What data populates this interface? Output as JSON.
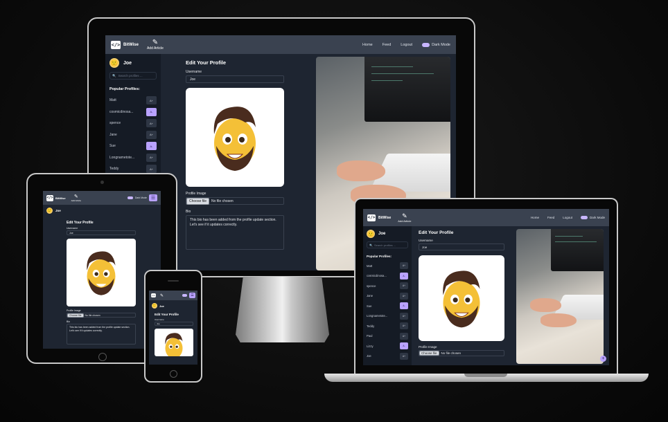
{
  "app": {
    "brand": "BitWise",
    "add_article": "Add Article",
    "nav_home": "Home",
    "nav_feed": "Feed",
    "nav_logout": "Logout",
    "dark_mode": "Dark Mode",
    "user_name": "Joe",
    "search_placeholder": "Search profiles ...",
    "popular_title": "Popular Profiles:",
    "page_title": "Edit Your Profile",
    "username_label": "Username",
    "username_value": "Joe",
    "profile_image_label": "Profile Image",
    "choose_file": "Choose file",
    "no_file": "No file chosen",
    "bio_label": "Bio",
    "bio_text": "This bio has been added from the profile update section. Let's see if it updates correctly.",
    "follow_icon": "A+",
    "unfollow_icon": "A-"
  },
  "profiles_desktop": [
    {
      "name": "Matt",
      "following": false
    },
    {
      "name": "cosmicdinosa...",
      "following": true
    },
    {
      "name": "spence",
      "following": false
    },
    {
      "name": "Jane",
      "following": false
    },
    {
      "name": "Sue",
      "following": true
    },
    {
      "name": "Longnametote...",
      "following": false
    },
    {
      "name": "Teddy",
      "following": false
    }
  ],
  "profiles_laptop": [
    {
      "name": "Matt",
      "following": false
    },
    {
      "name": "cosmicdinosa...",
      "following": true
    },
    {
      "name": "spence",
      "following": false
    },
    {
      "name": "Jane",
      "following": false
    },
    {
      "name": "Sue",
      "following": true
    },
    {
      "name": "Longnametote...",
      "following": false
    },
    {
      "name": "Teddy",
      "following": false
    },
    {
      "name": "Paul",
      "following": false
    },
    {
      "name": "Lizzy",
      "following": true
    },
    {
      "name": "Joe",
      "following": false
    }
  ],
  "colors": {
    "accent": "#b9a2ff",
    "navbar": "#3a4250",
    "sidebar": "#151b25",
    "background": "#1e2531"
  }
}
